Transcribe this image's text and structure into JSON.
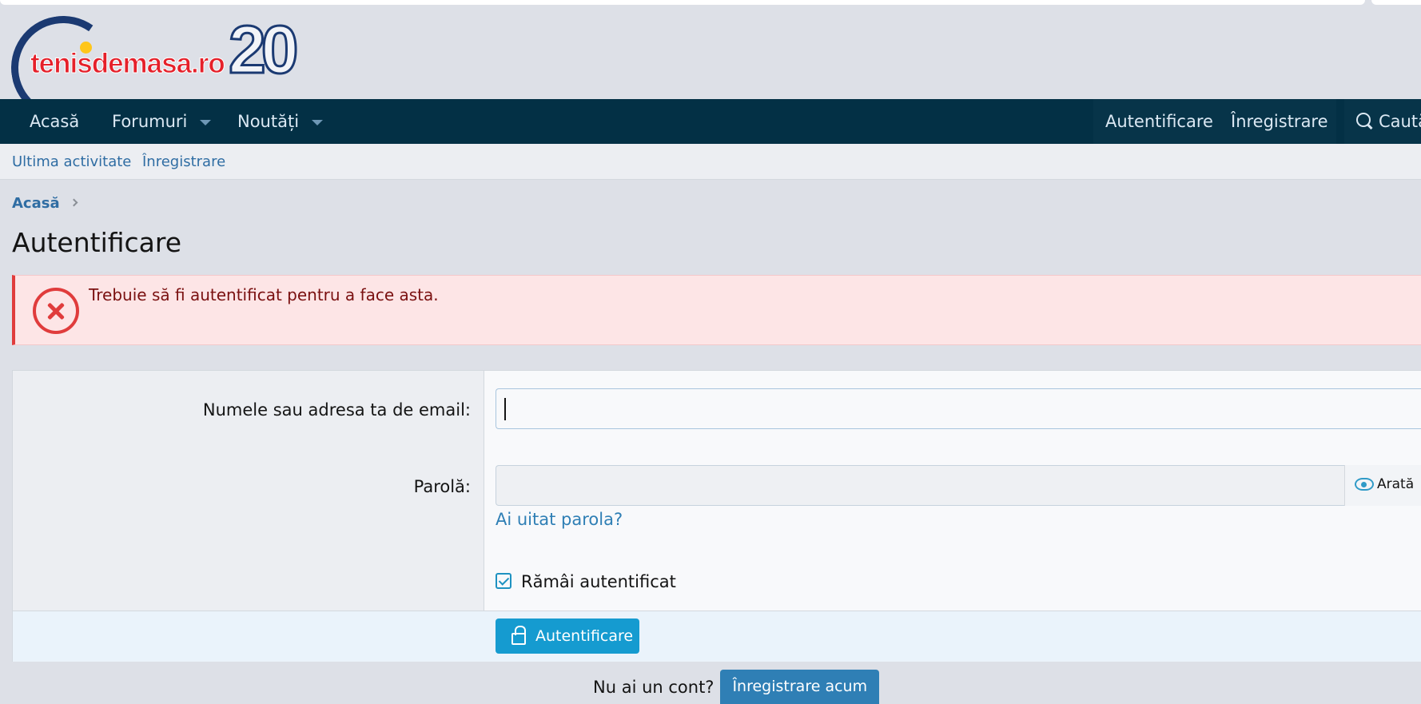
{
  "logo": {
    "brand": "tenisdemasa.ro",
    "badge": "20"
  },
  "nav": {
    "items": [
      {
        "label": "Acasă"
      },
      {
        "label": "Forumuri"
      },
      {
        "label": "Noutăți"
      }
    ],
    "login": "Autentificare",
    "register": "Înregistrare",
    "search": "Caută"
  },
  "subnav": {
    "items": [
      "Ultima activitate",
      "Înregistrare"
    ]
  },
  "breadcrumb": {
    "home": "Acasă"
  },
  "page": {
    "title": "Autentificare"
  },
  "error": {
    "message": "Trebuie să fi autentificat pentru a face asta."
  },
  "form": {
    "username_label": "Numele sau adresa ta de email:",
    "username_value": "",
    "password_label": "Parolă:",
    "password_value": "",
    "show_label": "Arată",
    "forgot_link": "Ai uitat parola?",
    "remember_label": "Rămâi autentificat",
    "remember_checked": true,
    "submit_label": "Autentificare"
  },
  "signup": {
    "prompt": "Nu ai un cont?",
    "button": "Înregistrare acum"
  },
  "colors": {
    "navbar": "#033045",
    "link": "#2f6da3",
    "primary_button": "#159bd0",
    "error": "#e03c3c"
  }
}
